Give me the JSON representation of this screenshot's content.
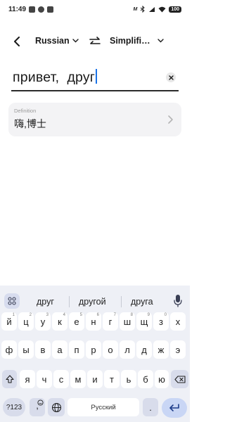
{
  "status_bar": {
    "time": "11:49",
    "net_label": "M",
    "battery": "100"
  },
  "lang_bar": {
    "source_lang": "Russian",
    "target_lang": "Simplifi…"
  },
  "input": {
    "text": "привет,  друг"
  },
  "definition": {
    "label": "Definition",
    "value": "嗨,博士"
  },
  "keyboard": {
    "suggestions": [
      "друг",
      "другой",
      "друга"
    ],
    "row1": [
      {
        "c": "й",
        "n": "1"
      },
      {
        "c": "ц",
        "n": "2"
      },
      {
        "c": "у",
        "n": "3"
      },
      {
        "c": "к",
        "n": "4"
      },
      {
        "c": "е",
        "n": "5"
      },
      {
        "c": "н",
        "n": "6"
      },
      {
        "c": "г",
        "n": "7"
      },
      {
        "c": "ш",
        "n": "8"
      },
      {
        "c": "щ",
        "n": "9"
      },
      {
        "c": "з",
        "n": "0"
      },
      {
        "c": "х",
        "n": ""
      }
    ],
    "row2": [
      "ф",
      "ы",
      "в",
      "а",
      "п",
      "р",
      "о",
      "л",
      "д",
      "ж",
      "э"
    ],
    "row3": [
      "я",
      "ч",
      "с",
      "м",
      "и",
      "т",
      "ь",
      "б",
      "ю"
    ],
    "symbols_label": "?123",
    "emoji_key_label": ",",
    "space_label": "Русский",
    "period_label": ".",
    "colors": {
      "background": "#eef0f6",
      "function_key": "#d8dceb",
      "enter_key": "#c9d6f5",
      "accent": "#1a73e8"
    }
  }
}
